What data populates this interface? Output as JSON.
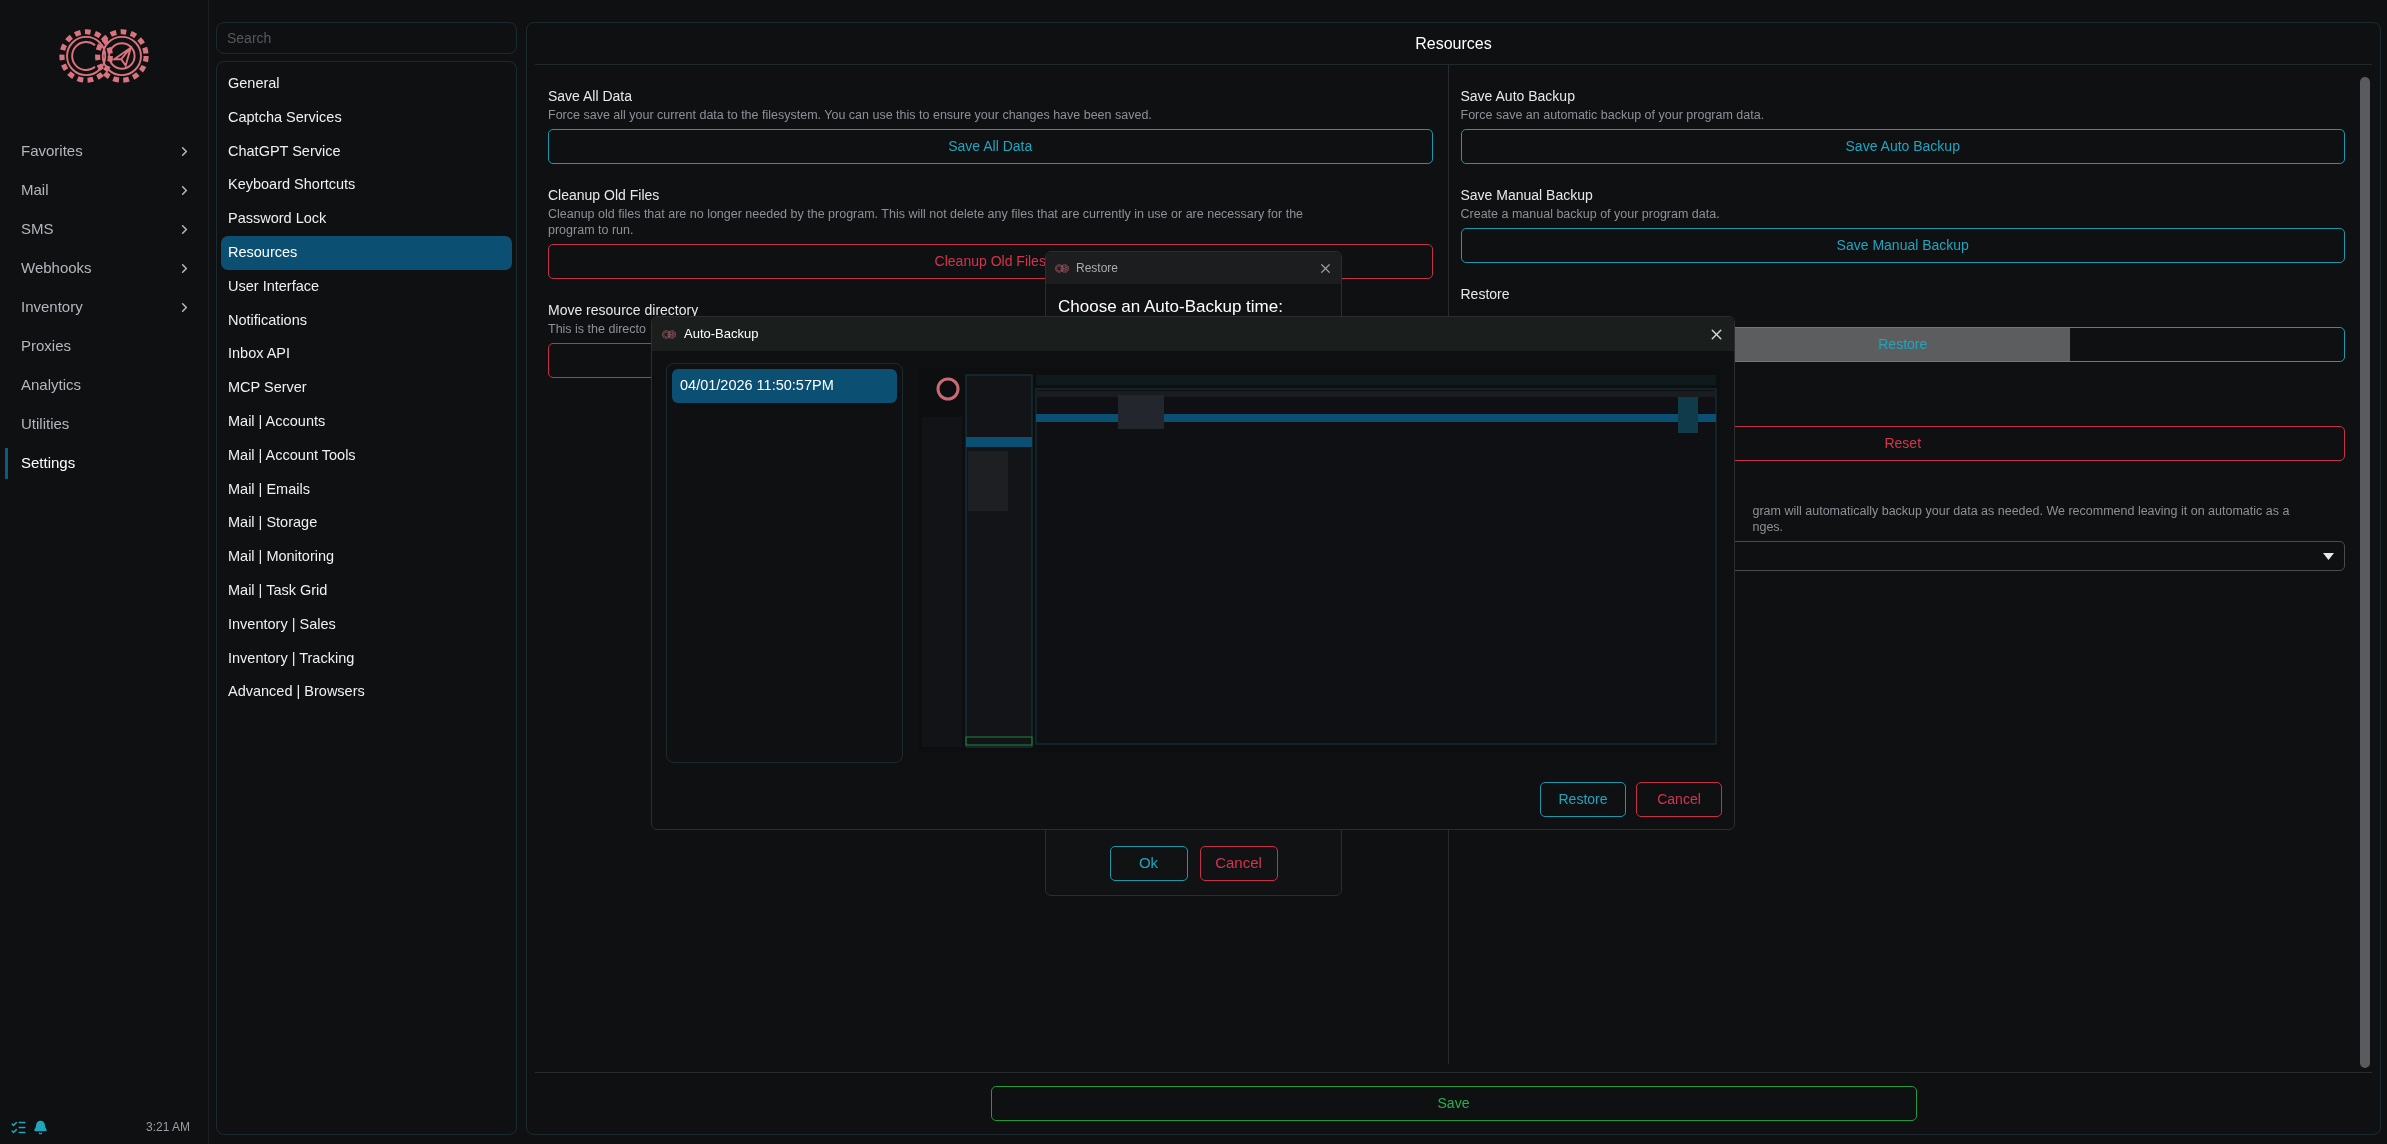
{
  "nav": {
    "items": [
      {
        "label": "Favorites",
        "expandable": true,
        "selected": false
      },
      {
        "label": "Mail",
        "expandable": true,
        "selected": false
      },
      {
        "label": "SMS",
        "expandable": true,
        "selected": false
      },
      {
        "label": "Webhooks",
        "expandable": true,
        "selected": false
      },
      {
        "label": "Inventory",
        "expandable": true,
        "selected": false
      },
      {
        "label": "Proxies",
        "expandable": false,
        "selected": false
      },
      {
        "label": "Analytics",
        "expandable": false,
        "selected": false
      },
      {
        "label": "Utilities",
        "expandable": false,
        "selected": false
      },
      {
        "label": "Settings",
        "expandable": false,
        "selected": true
      }
    ],
    "status_bar": {
      "time": "3:21 AM"
    }
  },
  "settings_list": {
    "search": {
      "placeholder": "Search"
    },
    "items": [
      {
        "label": "General",
        "selected": false
      },
      {
        "label": "Captcha Services",
        "selected": false
      },
      {
        "label": "ChatGPT Service",
        "selected": false
      },
      {
        "label": "Keyboard Shortcuts",
        "selected": false
      },
      {
        "label": "Password Lock",
        "selected": false
      },
      {
        "label": "Resources",
        "selected": true
      },
      {
        "label": "User Interface",
        "selected": false
      },
      {
        "label": "Notifications",
        "selected": false
      },
      {
        "label": "Inbox API",
        "selected": false
      },
      {
        "label": "MCP Server",
        "selected": false
      },
      {
        "label": "Mail | Accounts",
        "selected": false
      },
      {
        "label": "Mail | Account Tools",
        "selected": false
      },
      {
        "label": "Mail | Emails",
        "selected": false
      },
      {
        "label": "Mail | Storage",
        "selected": false
      },
      {
        "label": "Mail | Monitoring",
        "selected": false
      },
      {
        "label": "Mail | Task Grid",
        "selected": false
      },
      {
        "label": "Inventory | Sales",
        "selected": false
      },
      {
        "label": "Inventory | Tracking",
        "selected": false
      },
      {
        "label": "Advanced | Browsers",
        "selected": false
      }
    ]
  },
  "main": {
    "title": "Resources",
    "left": [
      {
        "title": "Save All Data",
        "description": [
          "Force save all your current data to the filesystem. You can use this to ensure your changes have been saved."
        ],
        "control": {
          "kind": "button",
          "label": "Save All Data"
        }
      },
      {
        "title": "Cleanup Old Files",
        "description": [
          "Cleanup old files that are no longer needed by the program. This will not delete any files that are currently in use or are necessary for the",
          "program to run."
        ],
        "control": {
          "kind": "button",
          "label": "Cleanup Old Files"
        }
      },
      {
        "title": "Move resource directory",
        "description": [
          "This is the directo"
        ],
        "control": {
          "kind": "button"
        }
      }
    ],
    "right": [
      {
        "title": "Save Auto Backup",
        "description": [
          "Force save an automatic backup of your program data."
        ],
        "control": {
          "kind": "button",
          "label": "Save Auto Backup"
        }
      },
      {
        "title": "Save Manual Backup",
        "description": [
          "Create a manual backup of your program data."
        ],
        "control": {
          "kind": "button",
          "label": "Save Manual Backup"
        }
      },
      {
        "title": "Restore",
        "control": {
          "kind": "button",
          "label": "Restore",
          "level": 0.69
        }
      },
      {
        "control": {
          "kind": "button",
          "label": "Reset"
        }
      },
      {
        "description": [
          "gram will automatically backup your data as needed. We recommend leaving it on automatic as a",
          "nges."
        ],
        "control": {
          "kind": "select"
        }
      }
    ],
    "save_button": "Save"
  },
  "restore_dialog": {
    "title": "Restore",
    "prompt": "Choose an Auto-Backup time:",
    "buttons": [
      {
        "label": "Ok"
      },
      {
        "label": "Cancel"
      }
    ]
  },
  "auto_backup_dialog": {
    "title": "Auto-Backup",
    "backups": [
      {
        "label": "04/01/2026 11:50:57PM",
        "selected": true
      }
    ],
    "buttons": [
      {
        "label": "Restore"
      },
      {
        "label": "Cancel"
      }
    ]
  }
}
